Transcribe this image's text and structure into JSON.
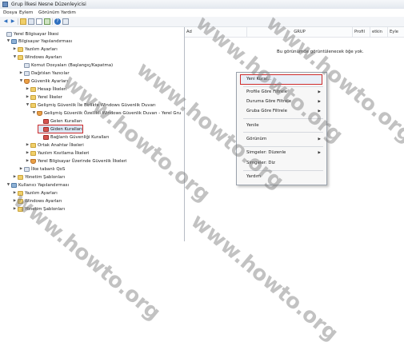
{
  "window": {
    "title": "Grup İlkesi Nesne Düzenleyicisi"
  },
  "menubar": {
    "items": [
      "Dosya",
      "Eylem",
      "Görünüm",
      "Yardım"
    ]
  },
  "toolbar": {
    "icons": [
      "back-arrow-icon",
      "forward-arrow-icon",
      "up-folder-icon",
      "show-tree-icon",
      "properties-icon",
      "export-icon",
      "help-icon",
      "console-icon"
    ]
  },
  "tree": {
    "items": [
      {
        "label": "Yerel Bilgisayar İlkesi",
        "icon": "policy",
        "arrow": ""
      },
      {
        "label": "Bilgisayar Yapılandırması",
        "icon": "computer",
        "arrow": "▼"
      },
      {
        "label": "Yazılım Ayarları",
        "icon": "folder",
        "arrow": "▶"
      },
      {
        "label": "Windows Ayarları",
        "icon": "folder",
        "arrow": "▼"
      },
      {
        "label": "Komut Dosyaları (Başlangıç/Kapatma)",
        "icon": "policy",
        "arrow": ""
      },
      {
        "label": "Dağıtılan Yazıcılar",
        "icon": "policy",
        "arrow": "▶"
      },
      {
        "label": "Güvenlik Ayarları",
        "icon": "shield",
        "arrow": "▼"
      },
      {
        "label": "Hesap İlkeleri",
        "icon": "folder",
        "arrow": "▶"
      },
      {
        "label": "Yerel İlkeler",
        "icon": "folder",
        "arrow": "▶"
      },
      {
        "label": "Gelişmiş Güvenlik İle Birlikte Windows Güvenlik Duvarı",
        "icon": "folder",
        "arrow": "▼"
      },
      {
        "label": "Gelişmiş Güvenlik Özellikli Windows Güvenlik Duvarı - Yerel Gru",
        "icon": "shield",
        "arrow": "▼"
      },
      {
        "label": "Gelen Kuralları",
        "icon": "rules",
        "arrow": ""
      },
      {
        "label": "Giden Kuralları",
        "icon": "rules",
        "arrow": ""
      },
      {
        "label": "Bağlantı Güvenliği Kuralları",
        "icon": "rules",
        "arrow": ""
      },
      {
        "label": "Ortak Anahtar İlkeleri",
        "icon": "folder",
        "arrow": "▶"
      },
      {
        "label": "Yazılım Kısıtlama İlkeleri",
        "icon": "folder",
        "arrow": "▶"
      },
      {
        "label": "Yerel Bilgisayar Üzerinde Güvenlik İlkeleri",
        "icon": "shield",
        "arrow": "▶"
      },
      {
        "label": "İlke tabanlı QoS",
        "icon": "policy",
        "arrow": "▶"
      },
      {
        "label": "Yönetim Şablonları",
        "icon": "folder",
        "arrow": "▶"
      },
      {
        "label": "Kullanıcı Yapılandırması",
        "icon": "computer",
        "arrow": "▼"
      },
      {
        "label": "Yazılım Ayarları",
        "icon": "folder",
        "arrow": "▶"
      },
      {
        "label": "Windows Ayarları",
        "icon": "folder",
        "arrow": "▶"
      },
      {
        "label": "Yönetim Şablonları",
        "icon": "folder",
        "arrow": "▶"
      }
    ]
  },
  "list": {
    "columns": [
      "Ad",
      "GRUP",
      "Profil",
      "etkin",
      "Eyle"
    ],
    "empty_message": "Bu görünümde görüntülenecek öğe yok."
  },
  "context_menu": {
    "items": [
      {
        "label": "Yeni Kural...",
        "submenu": false
      },
      {
        "label": "Profile Göre Filtrele",
        "submenu": true
      },
      {
        "label": "Duruma Göre Filtrele",
        "submenu": true
      },
      {
        "label": "Gruba Göre Filtrele",
        "submenu": true
      },
      {
        "label": "Yenile",
        "submenu": false
      },
      {
        "label": "Görünüm",
        "submenu": true
      },
      {
        "label": "Simgeler: Düzenle",
        "submenu": true
      },
      {
        "label": "Simgeler: Diz",
        "submenu": false
      },
      {
        "label": "Yardım",
        "submenu": false
      }
    ]
  },
  "watermark": {
    "text": "www.howto.org"
  },
  "colors": {
    "highlight_border": "#cf2b2b",
    "title_bg": "#e3e8ef"
  }
}
